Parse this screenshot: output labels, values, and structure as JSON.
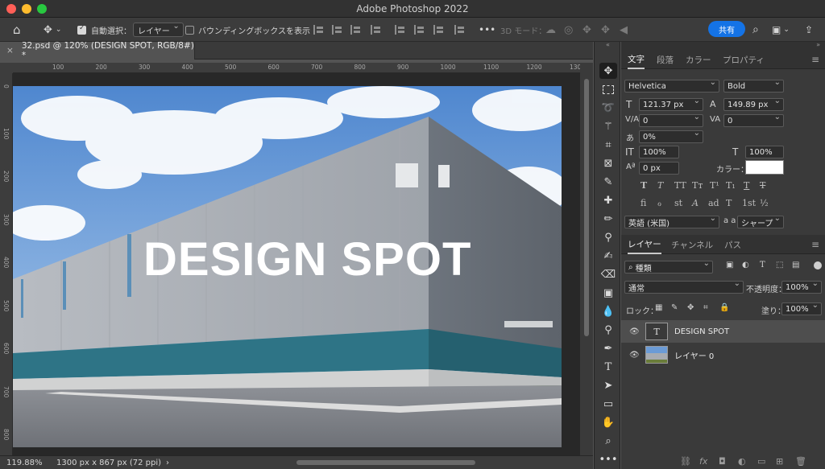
{
  "window": {
    "title": "Adobe Photoshop 2022",
    "traffic_colors": [
      "#ff5f57",
      "#febc2e",
      "#28c840"
    ]
  },
  "options_bar": {
    "auto_select_label": "自動選択：",
    "auto_select_value": "レイヤー",
    "bounding_box_label": "バウンディングボックスを表示",
    "mode_3d_label": "3D モード：",
    "more": "•••",
    "share_label": "共有"
  },
  "document": {
    "tab_label": "32.psd @ 120% (DESIGN SPOT, RGB/8#) *",
    "close_glyph": "×",
    "canvas_text": "DESIGN SPOT",
    "ruler_h": [
      "100",
      "200",
      "300",
      "400",
      "500",
      "600",
      "700",
      "800",
      "900",
      "1000",
      "1100",
      "1200",
      "1300"
    ],
    "ruler_v": [
      "0",
      "100",
      "200",
      "300",
      "400",
      "500",
      "600",
      "700",
      "800"
    ]
  },
  "status": {
    "zoom": "119.88%",
    "doc_size": "1300 px x 867 px (72 ppi)",
    "arrow": "›"
  },
  "tools": [
    "move-tool",
    "marquee-tool",
    "lasso-tool",
    "quick-select-tool",
    "crop-tool",
    "frame-tool",
    "eyedropper-tool",
    "healing-tool",
    "brush-tool",
    "stamp-tool",
    "history-brush-tool",
    "eraser-tool",
    "gradient-tool",
    "blur-tool",
    "dodge-tool",
    "pen-tool",
    "type-tool",
    "path-select-tool",
    "rectangle-tool",
    "hand-tool",
    "zoom-tool",
    "more-tool"
  ],
  "char_panel": {
    "tabs": [
      "文字",
      "段落",
      "カラー",
      "プロパティ"
    ],
    "font_family": "Helvetica",
    "font_style": "Bold",
    "size": "121.37 px",
    "leading": "149.89 px",
    "kerning": "0",
    "tracking": "0",
    "tsume": "0%",
    "vscale": "100%",
    "hscale": "100%",
    "baseline": "0 px",
    "color_label": "カラー：",
    "color_value": "#ffffff",
    "style_glyphs": [
      "T",
      "T",
      "TT",
      "Tт",
      "T¹",
      "T₁",
      "T",
      "T"
    ],
    "opentype_glyphs": [
      "fi",
      "ℴ",
      "st",
      "A",
      "ad",
      "T",
      "1st",
      "½"
    ],
    "language": "英語 (米国)",
    "aa_label": "a a",
    "antialias": "シャープ"
  },
  "layers_panel": {
    "tabs": [
      "レイヤー",
      "チャンネル",
      "パス"
    ],
    "filter_label": "種類",
    "blend_mode": "通常",
    "opacity_label": "不透明度：",
    "opacity": "100%",
    "lock_label": "ロック：",
    "fill_label": "塗り：",
    "fill": "100%",
    "layers": [
      {
        "name": "DESIGN SPOT",
        "kind": "text",
        "thumb_glyph": "T",
        "visible": true,
        "selected": true
      },
      {
        "name": "レイヤー 0",
        "kind": "image",
        "thumb_glyph": "",
        "visible": true,
        "selected": false
      }
    ],
    "footer_icons": [
      "link-icon",
      "fx-icon",
      "mask-icon",
      "adjustment-icon",
      "folder-icon",
      "new-layer-icon",
      "trash-icon"
    ],
    "footer_glyphs": [
      "⛓",
      "fx",
      "◘",
      "◐",
      "▭",
      "⊞",
      "🗑"
    ]
  }
}
